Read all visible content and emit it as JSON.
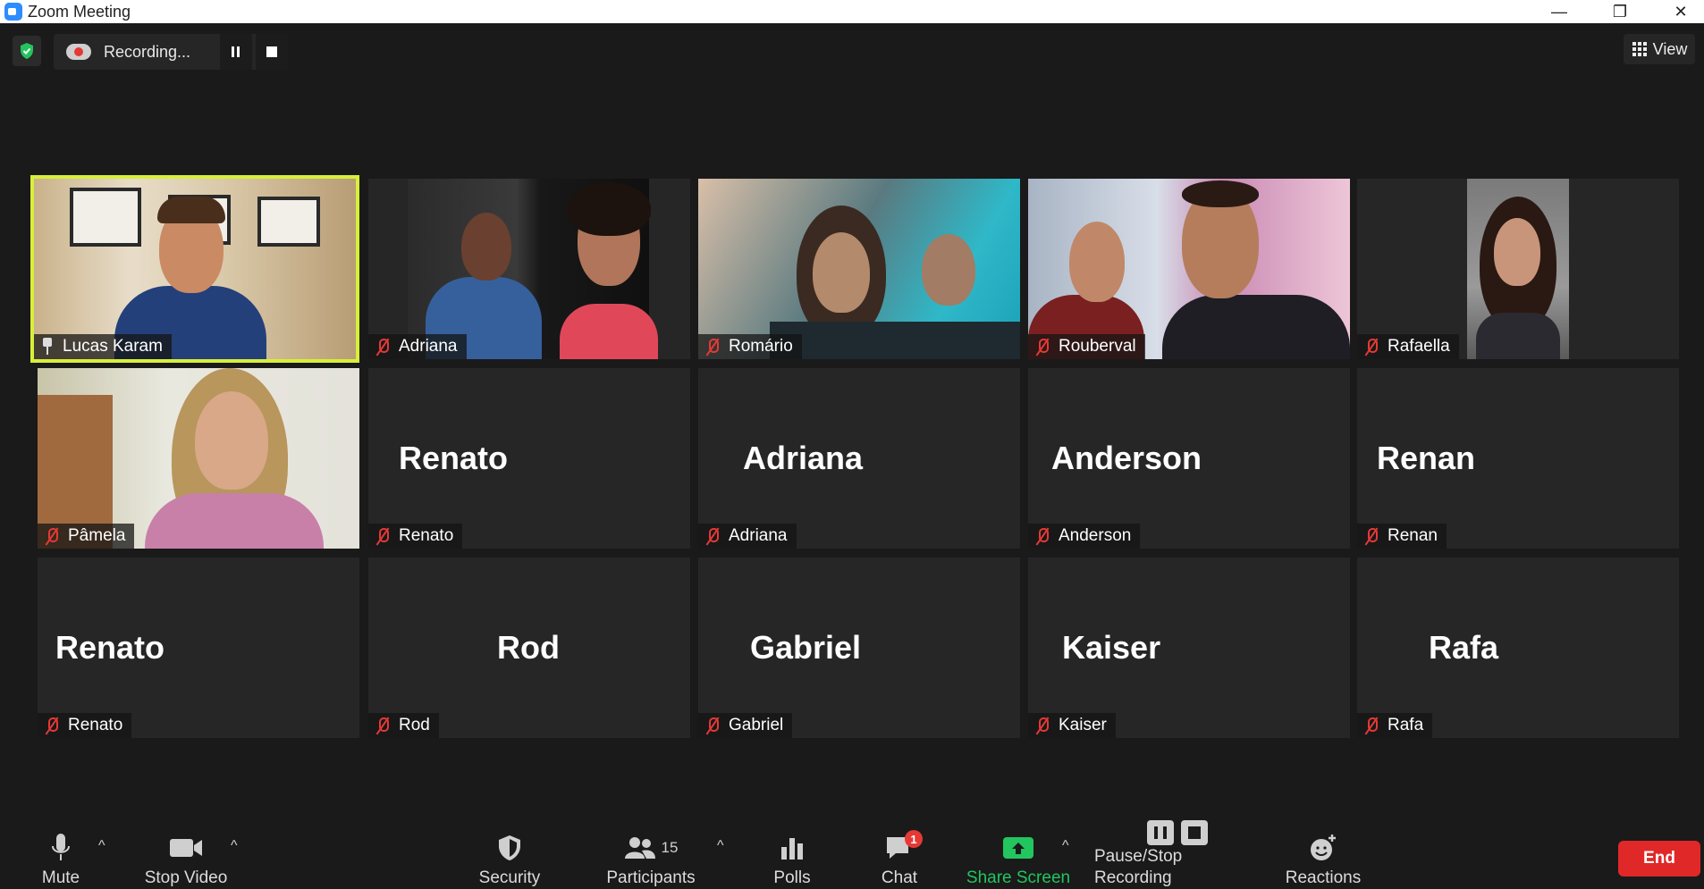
{
  "window": {
    "title": "Zoom Meeting",
    "minimize": "—",
    "restore": "❐",
    "close": "✕"
  },
  "recording": {
    "status": "Recording...",
    "pause_icon": "pause-icon",
    "stop_icon": "stop-icon"
  },
  "view": {
    "label": "View"
  },
  "participants": [
    {
      "name": "Lucas Karam",
      "video": true,
      "pinned": true,
      "active_speaker": true
    },
    {
      "name": "Adriana",
      "video": true,
      "muted": true
    },
    {
      "name": "Romário",
      "video": true,
      "muted": true
    },
    {
      "name": "Rouberval",
      "video": true,
      "muted": true
    },
    {
      "name": "Rafaella",
      "video": true,
      "muted": true
    },
    {
      "name": "Pâmela",
      "video": true,
      "muted": true
    },
    {
      "name": "Renato",
      "video": false,
      "muted": true
    },
    {
      "name": "Adriana",
      "video": false,
      "muted": true
    },
    {
      "name": "Anderson",
      "video": false,
      "muted": true
    },
    {
      "name": "Renan",
      "video": false,
      "muted": true
    },
    {
      "name": "Renato",
      "video": false,
      "muted": true
    },
    {
      "name": "Rod",
      "video": false,
      "muted": true
    },
    {
      "name": "Gabriel",
      "video": false,
      "muted": true
    },
    {
      "name": "Kaiser",
      "video": false,
      "muted": true
    },
    {
      "name": "Rafa",
      "video": false,
      "muted": true
    }
  ],
  "toolbar": {
    "mute": "Mute",
    "stop_video": "Stop Video",
    "security": "Security",
    "participants": "Participants",
    "participants_count": "15",
    "polls": "Polls",
    "chat": "Chat",
    "chat_badge": "1",
    "share_screen": "Share Screen",
    "pause_stop_recording": "Pause/Stop Recording",
    "reactions": "Reactions",
    "end": "End",
    "caret": "^"
  },
  "colors": {
    "active_speaker_border": "#d8ef3a",
    "share_green": "#22c55e",
    "end_red": "#e02828",
    "muted_red": "#e53935",
    "badge_red": "#e53935"
  }
}
